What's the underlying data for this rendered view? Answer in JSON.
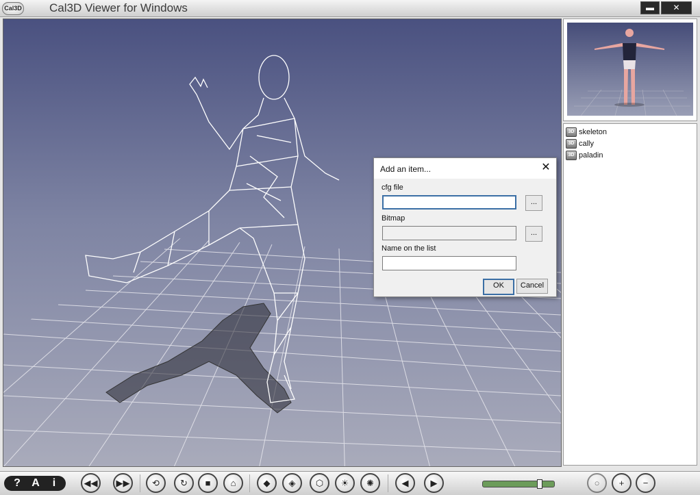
{
  "window": {
    "logo": "Cal3D",
    "title": "Cal3D Viewer for Windows",
    "minimize_label": "▬",
    "close_label": "✕"
  },
  "model_list": {
    "items": [
      {
        "label": "skeleton"
      },
      {
        "label": "cally"
      },
      {
        "label": "paladin"
      }
    ],
    "icon_text": "3D"
  },
  "dialog": {
    "title": "Add an item...",
    "close_label": "✕",
    "cfg_label": "cfg file",
    "cfg_value": "",
    "bitmap_label": "Bitmap",
    "bitmap_value": "",
    "name_label": "Name on the list",
    "name_value": "",
    "browse_label": "...",
    "ok_label": "OK",
    "cancel_label": "Cancel"
  },
  "toolbar": {
    "help_label": "?",
    "font_label": "A",
    "info_label": "i",
    "buttons": [
      {
        "name": "rewind-icon",
        "glyph": "◀◀"
      },
      {
        "name": "fast-forward-icon",
        "glyph": "▶▶"
      },
      {
        "name": "rotate-icon",
        "glyph": "⟲"
      },
      {
        "name": "reset-icon",
        "glyph": "↻"
      },
      {
        "name": "stop-icon",
        "glyph": "■"
      },
      {
        "name": "home-icon",
        "glyph": "⌂"
      },
      {
        "name": "cube-icon",
        "glyph": "◆"
      },
      {
        "name": "textured-cube-icon",
        "glyph": "◈"
      },
      {
        "name": "wireframe-icon",
        "glyph": "⬡"
      },
      {
        "name": "light-icon",
        "glyph": "☀"
      },
      {
        "name": "skeleton-points-icon",
        "glyph": "✺"
      },
      {
        "name": "previous-icon",
        "glyph": "◀"
      },
      {
        "name": "next-icon",
        "glyph": "▶"
      },
      {
        "name": "blank-icon",
        "glyph": "○"
      },
      {
        "name": "zoom-in-icon",
        "glyph": "+"
      },
      {
        "name": "zoom-out-icon",
        "glyph": "−"
      }
    ],
    "speed_fraction": 0.8
  }
}
